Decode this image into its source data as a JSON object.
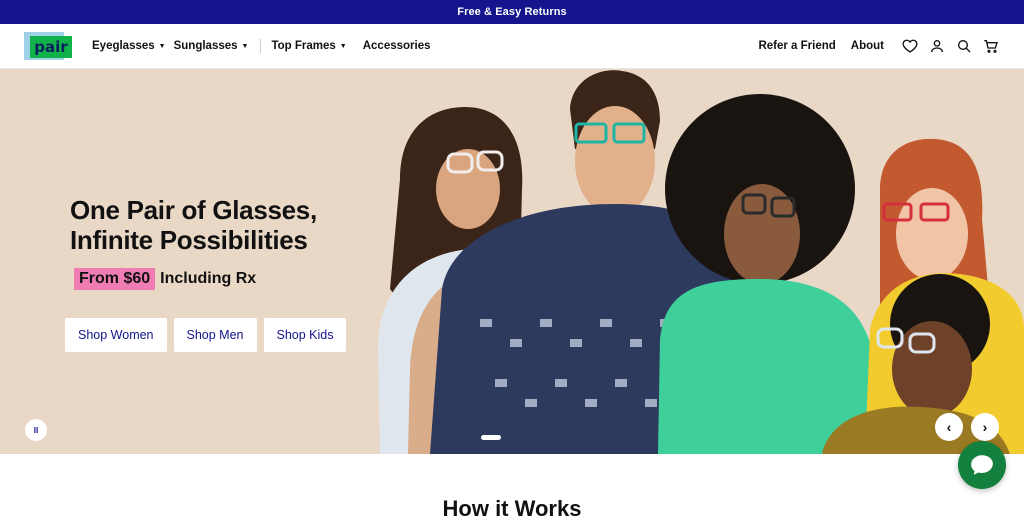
{
  "promo": {
    "text": "Free & Easy Returns"
  },
  "header": {
    "logo_text": "pair",
    "nav": [
      {
        "label": "Eyeglasses",
        "has_caret": true
      },
      {
        "label": "Sunglasses",
        "has_caret": true
      },
      {
        "label": "Top Frames",
        "has_caret": true
      },
      {
        "label": "Accessories",
        "has_caret": false
      }
    ],
    "refer_label": "Refer a Friend",
    "about_label": "About",
    "icons": [
      "heart-icon",
      "account-icon",
      "search-icon",
      "cart-icon"
    ]
  },
  "hero": {
    "title_line1": "One Pair of Glasses,",
    "title_line2": "Infinite Possibilities",
    "price_badge": "From $60",
    "price_suffix": "Including Rx",
    "buttons": [
      "Shop Women",
      "Shop Men",
      "Shop Kids"
    ],
    "pause_symbol": "II",
    "prev_symbol": "‹",
    "next_symbol": "›"
  },
  "section": {
    "heading": "How it Works"
  },
  "colors": {
    "promo_bg": "#14148c",
    "hero_bg": "#ead8c7",
    "price_badge_bg": "#f07cb4",
    "logo_green": "#12b24a",
    "chat_green": "#13803d",
    "cta_text": "#14148c"
  }
}
